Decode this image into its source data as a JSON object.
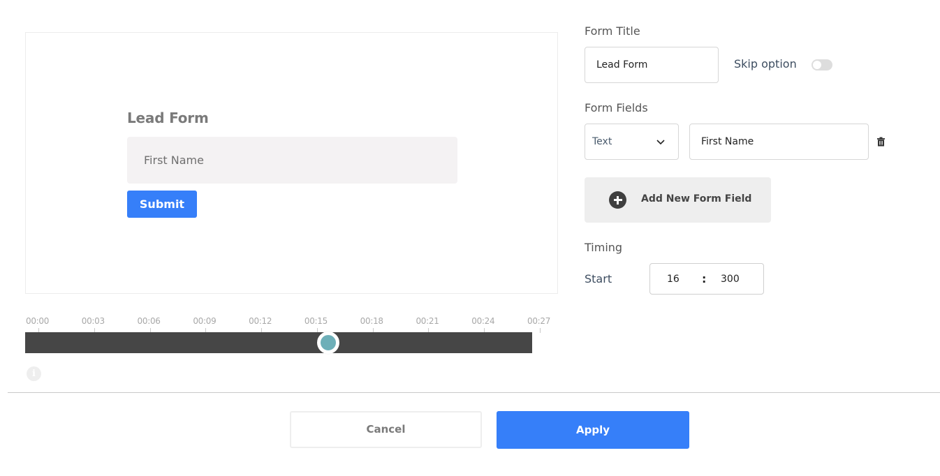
{
  "preview": {
    "title": "Lead Form",
    "field_placeholder": "First Name",
    "submit_label": "Submit"
  },
  "timeline": {
    "ticks": [
      "00:00",
      "00:03",
      "00:06",
      "00:09",
      "00:12",
      "00:15",
      "00:18",
      "00:21",
      "00:24",
      "00:27"
    ],
    "tick_interval_seconds": 3,
    "duration_seconds": 27.3,
    "thumb_position_seconds": 16.3,
    "track_color": "#464646",
    "thumb_color": "#6dafb8"
  },
  "info_icon": "info-icon",
  "form": {
    "title_label": "Form Title",
    "title_value": "Lead Form",
    "skip_option_label": "Skip option",
    "skip_option_enabled": false,
    "fields_label": "Form Fields",
    "fields": [
      {
        "type": "Text",
        "name": "First Name"
      }
    ],
    "add_field_label": "Add New Form Field",
    "timing_label": "Timing",
    "start_label": "Start",
    "start_seconds": "16",
    "start_separator": ":",
    "start_milliseconds": "300"
  },
  "footer": {
    "cancel_label": "Cancel",
    "apply_label": "Apply",
    "accent_color": "#367ff9"
  }
}
